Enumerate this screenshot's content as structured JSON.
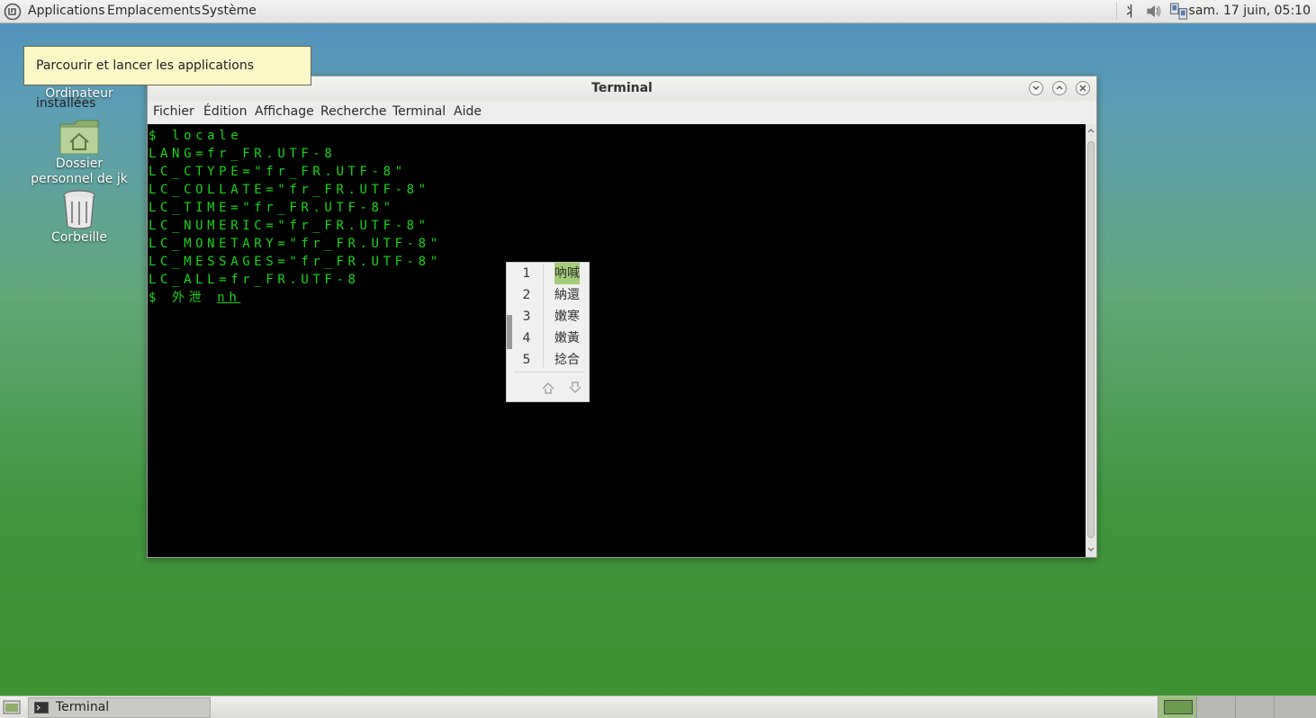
{
  "top_panel": {
    "menus": [
      "Applications",
      "Emplacements",
      "Système"
    ],
    "clock": "sam. 17 juin, 05:10",
    "tray_icons": [
      "input-method-icon",
      "volume-icon",
      "network-icon"
    ],
    "input_method_glyph": "丬"
  },
  "tooltip": {
    "text": "Parcourir et lancer les applications installées"
  },
  "desktop": {
    "icons": [
      {
        "label": "Ordinateur"
      },
      {
        "label": "Dossier personnel de jk"
      },
      {
        "label": "Corbeille"
      }
    ]
  },
  "window": {
    "title": "Terminal",
    "menu": [
      "Fichier",
      "Édition",
      "Affichage",
      "Recherche",
      "Terminal",
      "Aide"
    ],
    "terminal_lines": [
      "$ locale",
      "LANG=fr_FR.UTF-8",
      "LC_CTYPE=\"fr_FR.UTF-8\"",
      "LC_COLLATE=\"fr_FR.UTF-8\"",
      "LC_TIME=\"fr_FR.UTF-8\"",
      "LC_NUMERIC=\"fr_FR.UTF-8\"",
      "LC_MONETARY=\"fr_FR.UTF-8\"",
      "LC_MESSAGES=\"fr_FR.UTF-8\"",
      "LC_ALL=fr_FR.UTF-8"
    ],
    "prompt_committed": "$ 外泄",
    "prompt_preedit": "nh",
    "terminal_text_color": "#18d418"
  },
  "candidates": {
    "items": [
      {
        "num": "1",
        "word": "吶喊",
        "selected": true
      },
      {
        "num": "2",
        "word": "納還",
        "selected": false
      },
      {
        "num": "3",
        "word": "嫩寒",
        "selected": false
      },
      {
        "num": "4",
        "word": "嫩黃",
        "selected": false
      },
      {
        "num": "5",
        "word": "捻合",
        "selected": false
      }
    ],
    "selection_color": "#a3cc7a"
  },
  "bottom_panel": {
    "task_label": "Terminal"
  }
}
